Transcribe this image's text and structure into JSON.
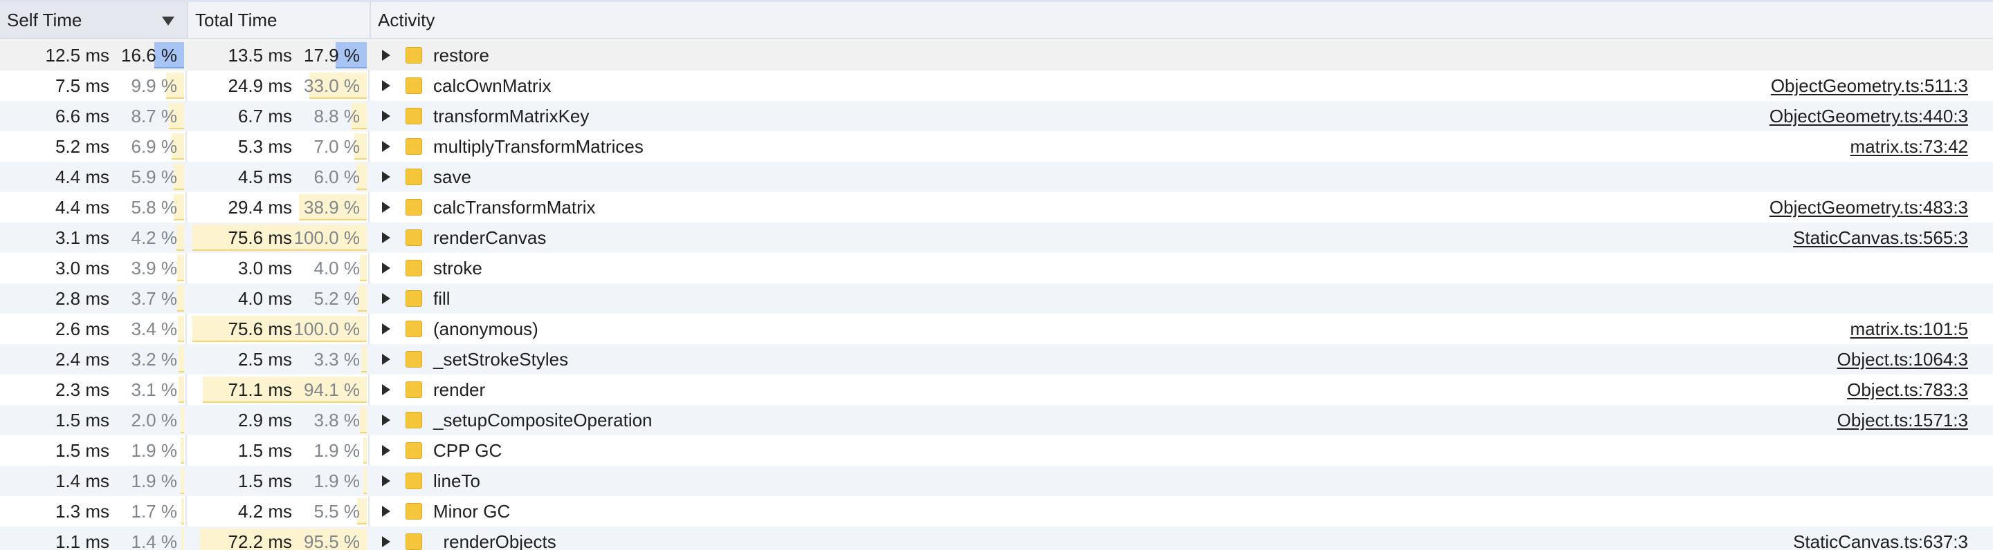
{
  "header": {
    "self_time": "Self Time",
    "total_time": "Total Time",
    "activity": "Activity"
  },
  "colors": {
    "bar_fill": "#fdf4cf",
    "bar_edge": "#f5d56c",
    "selected_bar": "#a8c4f5",
    "folder": "#f5c63c",
    "alt_row": "#f1f4f9"
  },
  "rows": [
    {
      "self_ms": "12.5 ms",
      "self_pct": "16.6 %",
      "self_frac": 0.166,
      "total_ms": "13.5 ms",
      "total_pct": "17.9 %",
      "total_frac": 0.179,
      "activity": "restore",
      "source": "",
      "selected": true
    },
    {
      "self_ms": "7.5 ms",
      "self_pct": "9.9 %",
      "self_frac": 0.099,
      "total_ms": "24.9 ms",
      "total_pct": "33.0 %",
      "total_frac": 0.33,
      "activity": "calcOwnMatrix",
      "source": "ObjectGeometry.ts:511:3"
    },
    {
      "self_ms": "6.6 ms",
      "self_pct": "8.7 %",
      "self_frac": 0.087,
      "total_ms": "6.7 ms",
      "total_pct": "8.8 %",
      "total_frac": 0.088,
      "activity": "transformMatrixKey",
      "source": "ObjectGeometry.ts:440:3"
    },
    {
      "self_ms": "5.2 ms",
      "self_pct": "6.9 %",
      "self_frac": 0.069,
      "total_ms": "5.3 ms",
      "total_pct": "7.0 %",
      "total_frac": 0.07,
      "activity": "multiplyTransformMatrices",
      "source": "matrix.ts:73:42"
    },
    {
      "self_ms": "4.4 ms",
      "self_pct": "5.9 %",
      "self_frac": 0.059,
      "total_ms": "4.5 ms",
      "total_pct": "6.0 %",
      "total_frac": 0.06,
      "activity": "save",
      "source": ""
    },
    {
      "self_ms": "4.4 ms",
      "self_pct": "5.8 %",
      "self_frac": 0.058,
      "total_ms": "29.4 ms",
      "total_pct": "38.9 %",
      "total_frac": 0.389,
      "activity": "calcTransformMatrix",
      "source": "ObjectGeometry.ts:483:3"
    },
    {
      "self_ms": "3.1 ms",
      "self_pct": "4.2 %",
      "self_frac": 0.042,
      "total_ms": "75.6 ms",
      "total_pct": "100.0 %",
      "total_frac": 1.0,
      "activity": "renderCanvas",
      "source": "StaticCanvas.ts:565:3"
    },
    {
      "self_ms": "3.0 ms",
      "self_pct": "3.9 %",
      "self_frac": 0.039,
      "total_ms": "3.0 ms",
      "total_pct": "4.0 %",
      "total_frac": 0.04,
      "activity": "stroke",
      "source": ""
    },
    {
      "self_ms": "2.8 ms",
      "self_pct": "3.7 %",
      "self_frac": 0.037,
      "total_ms": "4.0 ms",
      "total_pct": "5.2 %",
      "total_frac": 0.052,
      "activity": "fill",
      "source": ""
    },
    {
      "self_ms": "2.6 ms",
      "self_pct": "3.4 %",
      "self_frac": 0.034,
      "total_ms": "75.6 ms",
      "total_pct": "100.0 %",
      "total_frac": 1.0,
      "activity": "(anonymous)",
      "source": "matrix.ts:101:5"
    },
    {
      "self_ms": "2.4 ms",
      "self_pct": "3.2 %",
      "self_frac": 0.032,
      "total_ms": "2.5 ms",
      "total_pct": "3.3 %",
      "total_frac": 0.033,
      "activity": "_setStrokeStyles",
      "source": "Object.ts:1064:3"
    },
    {
      "self_ms": "2.3 ms",
      "self_pct": "3.1 %",
      "self_frac": 0.031,
      "total_ms": "71.1 ms",
      "total_pct": "94.1 %",
      "total_frac": 0.941,
      "activity": "render",
      "source": "Object.ts:783:3"
    },
    {
      "self_ms": "1.5 ms",
      "self_pct": "2.0 %",
      "self_frac": 0.02,
      "total_ms": "2.9 ms",
      "total_pct": "3.8 %",
      "total_frac": 0.038,
      "activity": "_setupCompositeOperation",
      "source": "Object.ts:1571:3"
    },
    {
      "self_ms": "1.5 ms",
      "self_pct": "1.9 %",
      "self_frac": 0.019,
      "total_ms": "1.5 ms",
      "total_pct": "1.9 %",
      "total_frac": 0.019,
      "activity": "CPP GC",
      "source": ""
    },
    {
      "self_ms": "1.4 ms",
      "self_pct": "1.9 %",
      "self_frac": 0.019,
      "total_ms": "1.5 ms",
      "total_pct": "1.9 %",
      "total_frac": 0.019,
      "activity": "lineTo",
      "source": ""
    },
    {
      "self_ms": "1.3 ms",
      "self_pct": "1.7 %",
      "self_frac": 0.017,
      "total_ms": "4.2 ms",
      "total_pct": "5.5 %",
      "total_frac": 0.055,
      "activity": "Minor GC",
      "source": ""
    },
    {
      "self_ms": "1.1 ms",
      "self_pct": "1.4 %",
      "self_frac": 0.014,
      "total_ms": "72.2 ms",
      "total_pct": "95.5 %",
      "total_frac": 0.955,
      "activity": "_renderObjects",
      "source": "StaticCanvas.ts:637:3"
    }
  ]
}
